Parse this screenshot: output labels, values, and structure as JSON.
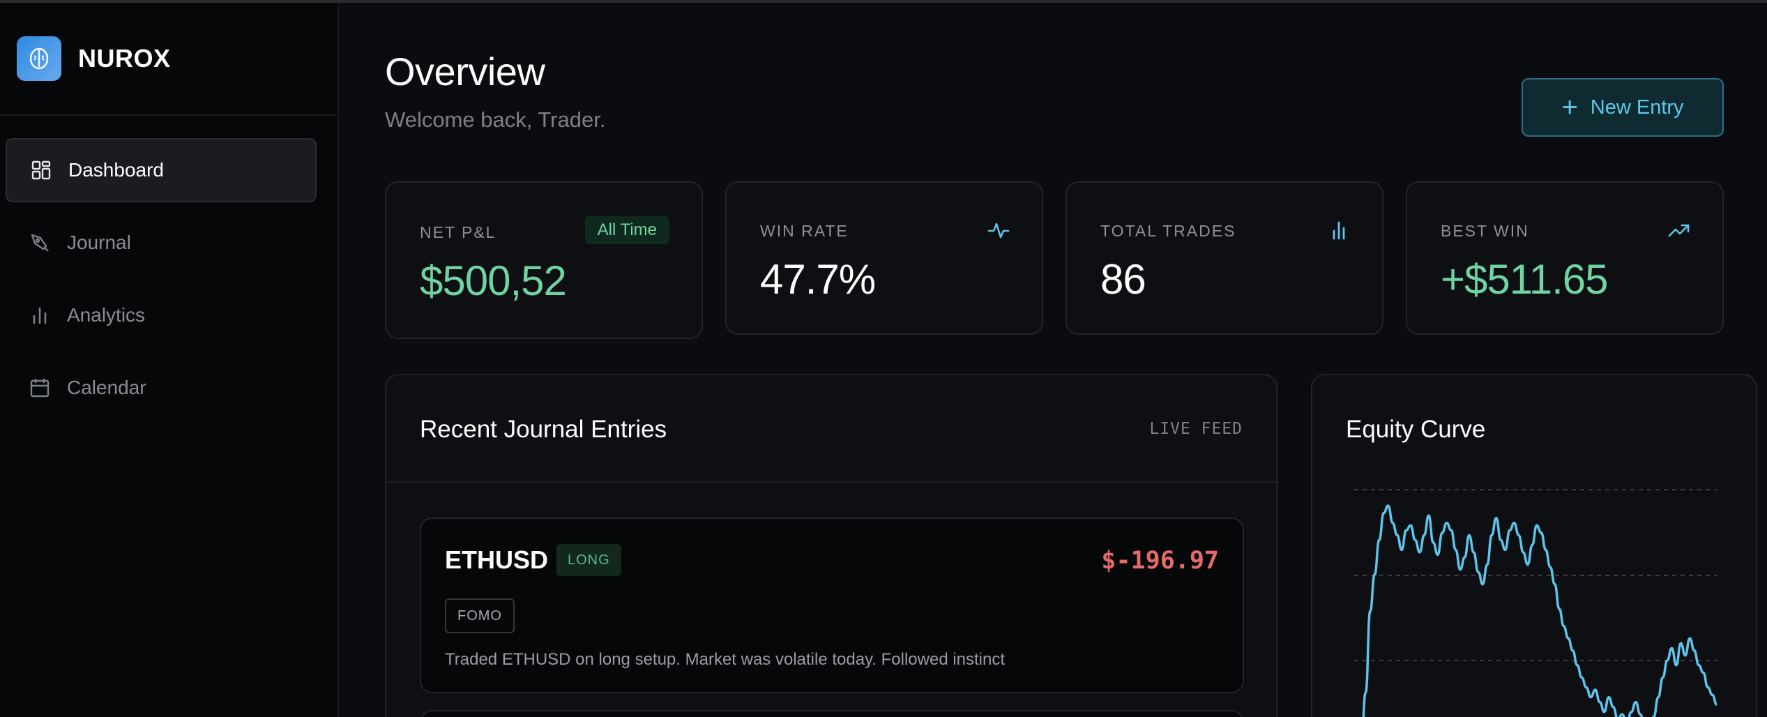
{
  "brand": {
    "name": "NUROX",
    "logo_icon": "brain-icon",
    "logo_color": "#2f8be0"
  },
  "sidebar": {
    "items": [
      {
        "label": "Dashboard",
        "icon": "dashboard-grid-icon",
        "active": true
      },
      {
        "label": "Journal",
        "icon": "pen-nib-icon",
        "active": false
      },
      {
        "label": "Analytics",
        "icon": "bar-chart-icon",
        "active": false
      },
      {
        "label": "Calendar",
        "icon": "calendar-icon",
        "active": false
      }
    ]
  },
  "header": {
    "title": "Overview",
    "subtitle": "Welcome back, Trader.",
    "new_entry_label": "New Entry"
  },
  "stats": [
    {
      "label": "NET P&L",
      "value": "$500,52",
      "badge": "All Time",
      "color": "#6fd3a2"
    },
    {
      "label": "WIN RATE",
      "value": "47.7%",
      "icon": "activity-pulse-icon"
    },
    {
      "label": "TOTAL TRADES",
      "value": "86",
      "icon": "bar-chart-icon"
    },
    {
      "label": "BEST WIN",
      "value": "+$511.65",
      "icon": "trending-up-icon",
      "color": "#6fd3a2"
    }
  ],
  "journal": {
    "title": "Recent Journal Entries",
    "feed_label": "LIVE FEED",
    "entries": [
      {
        "symbol": "ETHUSD",
        "side": "LONG",
        "pnl": "$-196.97",
        "tag": "FOMO",
        "note": "Traded ETHUSD on long setup. Market was volatile today. Followed instinct"
      }
    ]
  },
  "equity": {
    "title": "Equity Curve",
    "line_color": "#5fc4ea"
  },
  "chart_data": {
    "type": "line",
    "title": "Equity Curve",
    "xlabel": "",
    "ylabel": "",
    "grid": true,
    "ylim": [
      0,
      100
    ],
    "series": [
      {
        "values": [
          0,
          22,
          55,
          70,
          84,
          95,
          98,
          91,
          86,
          80,
          88,
          90,
          84,
          79,
          86,
          94,
          83,
          78,
          87,
          91,
          88,
          80,
          72,
          77,
          86,
          79,
          71,
          66,
          74,
          86,
          93,
          84,
          80,
          88,
          91,
          86,
          79,
          74,
          82,
          90,
          87,
          80,
          73,
          66,
          56,
          49,
          44,
          39,
          33,
          28,
          24,
          20,
          23,
          18,
          14,
          20,
          16,
          11,
          13,
          9,
          14,
          18,
          13,
          8,
          6,
          12,
          20,
          28,
          35,
          40,
          33,
          42,
          37,
          44,
          39,
          33,
          30,
          24,
          21,
          17
        ]
      }
    ]
  }
}
